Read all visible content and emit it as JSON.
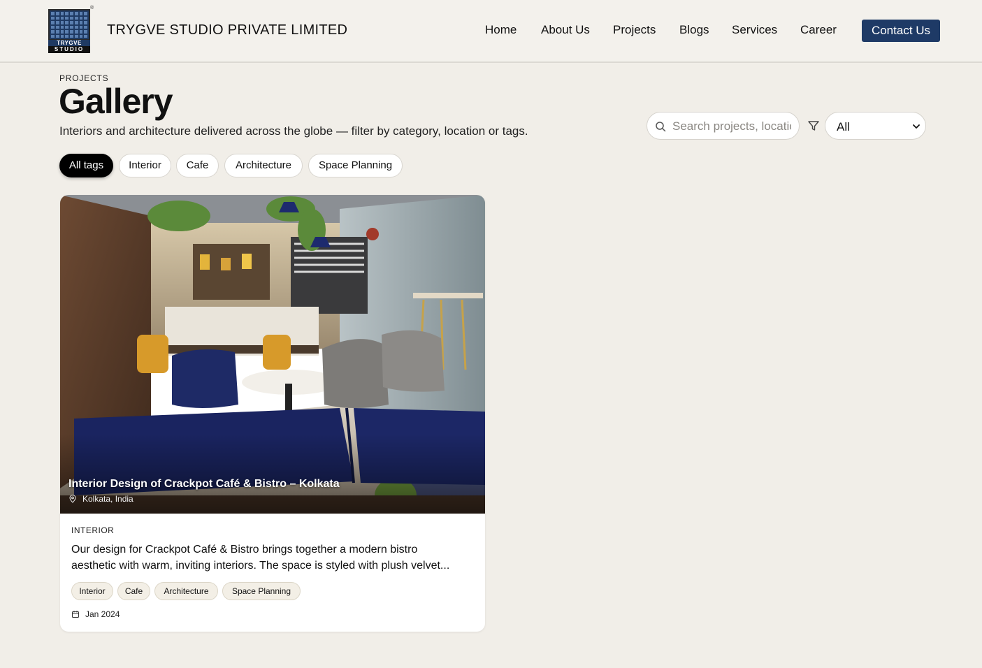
{
  "header": {
    "logo_text_top": "TRYGVE",
    "logo_text_bottom": "STUDIO",
    "brand": "TRYGVE STUDIO PRIVATE LIMITED",
    "nav": [
      "Home",
      "About Us",
      "Projects",
      "Blogs",
      "Services",
      "Career"
    ],
    "contact_label": "Contact Us",
    "accent_color": "#1e3a66"
  },
  "page": {
    "kicker": "PROJECTS",
    "title": "Gallery",
    "subtitle": "Interiors and architecture delivered across the globe — filter by category, location or tags."
  },
  "search": {
    "placeholder": "Search projects, location, tags",
    "icon": "search-icon"
  },
  "filter": {
    "icon": "filter-icon",
    "selected": "All"
  },
  "tags": [
    "All tags",
    "Interior",
    "Cafe",
    "Architecture",
    "Space Planning"
  ],
  "card": {
    "title": "Interior Design of Crackpot Café & Bistro – Kolkata",
    "location": "Kolkata, India",
    "category": "INTERIOR",
    "description_line1": "Our design for Crackpot Café & Bistro brings together a modern bistro",
    "description_line2": "aesthetic with warm, inviting interiors. The space is styled with plush velvet...",
    "tags": [
      "Interior",
      "Cafe",
      "Architecture",
      "Space Planning"
    ],
    "date": "Jan 2024"
  }
}
